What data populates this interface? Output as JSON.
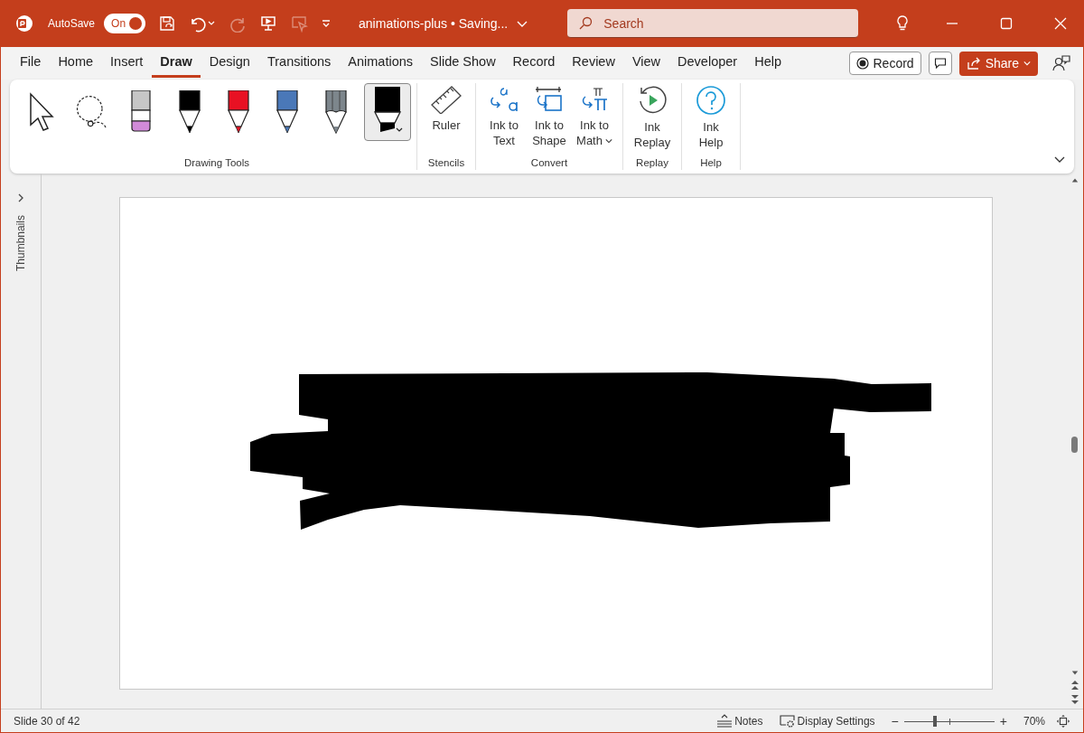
{
  "title_bar": {
    "autosave": {
      "label": "AutoSave",
      "on": true,
      "state_text": "On"
    },
    "quick_access": [
      {
        "kind": "save",
        "disabled": false
      },
      {
        "kind": "undo",
        "disabled": false
      },
      {
        "kind": "redo",
        "disabled": true
      },
      {
        "kind": "present",
        "disabled": false
      },
      {
        "kind": "record",
        "disabled": true
      },
      {
        "kind": "customize",
        "disabled": false
      }
    ],
    "document_title": "animations-plus • Saving...",
    "search": {
      "placeholder": "Search"
    }
  },
  "tabs": [
    {
      "label": "File",
      "selected": false
    },
    {
      "label": "Home",
      "selected": false
    },
    {
      "label": "Insert",
      "selected": false
    },
    {
      "label": "Draw",
      "selected": true
    },
    {
      "label": "Design",
      "selected": false
    },
    {
      "label": "Transitions",
      "selected": false
    },
    {
      "label": "Animations",
      "selected": false
    },
    {
      "label": "Slide Show",
      "selected": false
    },
    {
      "label": "Record",
      "selected": false
    },
    {
      "label": "Review",
      "selected": false
    },
    {
      "label": "View",
      "selected": false
    },
    {
      "label": "Developer",
      "selected": false
    },
    {
      "label": "Help",
      "selected": false
    }
  ],
  "tab_actions": {
    "record": "Record",
    "share": "Share"
  },
  "ribbon": {
    "drawing_tools": {
      "label": "Drawing Tools",
      "tools": [
        {
          "kind": "select",
          "selected": false
        },
        {
          "kind": "lasso",
          "selected": false
        },
        {
          "kind": "eraser",
          "selected": false
        },
        {
          "kind": "pen",
          "color": "#000000",
          "selected": false
        },
        {
          "kind": "pen",
          "color": "#e81123",
          "selected": false
        },
        {
          "kind": "pen",
          "color": "#4a78b8",
          "selected": false
        },
        {
          "kind": "pencil",
          "color": "#7d868c",
          "selected": false
        },
        {
          "kind": "highlighter",
          "color": "#000000",
          "selected": true
        }
      ]
    },
    "groups": [
      {
        "label": "Stencils",
        "commands": [
          {
            "kind": "ruler",
            "lines": [
              "Ruler"
            ],
            "dropdown": false
          }
        ]
      },
      {
        "label": "Convert",
        "commands": [
          {
            "kind": "ink-to-text",
            "lines": [
              "Ink to",
              "Text"
            ],
            "dropdown": false
          },
          {
            "kind": "ink-to-shape",
            "lines": [
              "Ink to",
              "Shape"
            ],
            "dropdown": false
          },
          {
            "kind": "ink-to-math",
            "lines": [
              "Ink to",
              "Math"
            ],
            "dropdown": true
          }
        ]
      },
      {
        "label": "Replay",
        "commands": [
          {
            "kind": "replay",
            "lines": [
              "Ink",
              "Replay"
            ],
            "dropdown": false
          }
        ]
      },
      {
        "label": "Help",
        "commands": [
          {
            "kind": "help",
            "lines": [
              "Ink",
              "Help"
            ],
            "dropdown": false
          }
        ]
      }
    ]
  },
  "sidebar": {
    "label": "Thumbnails"
  },
  "status_bar": {
    "slide_info": "Slide 30 of 42",
    "notes": "Notes",
    "display_settings": "Display Settings",
    "zoom_out": "−",
    "zoom_in": "+",
    "zoom": {
      "level": 0.34
    },
    "zoom_text": "70%"
  }
}
